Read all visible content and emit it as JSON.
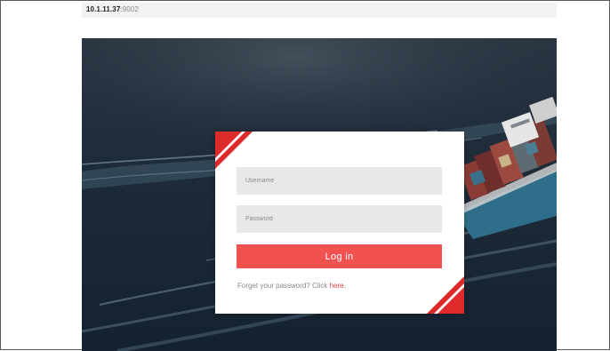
{
  "browser": {
    "address_host": "10.1.11.37",
    "address_port": ":9002"
  },
  "login": {
    "username_placeholder": "Username",
    "password_placeholder": "Password",
    "login_label": "Log in",
    "forgot_prefix": "Forget your password? Click ",
    "forgot_link": "here",
    "forgot_suffix": "."
  },
  "colors": {
    "accent": "#f2524f",
    "corner_stripe": "#dd2a2a",
    "field_background": "#e8e8e8",
    "hero_sea": "#1c2936"
  }
}
